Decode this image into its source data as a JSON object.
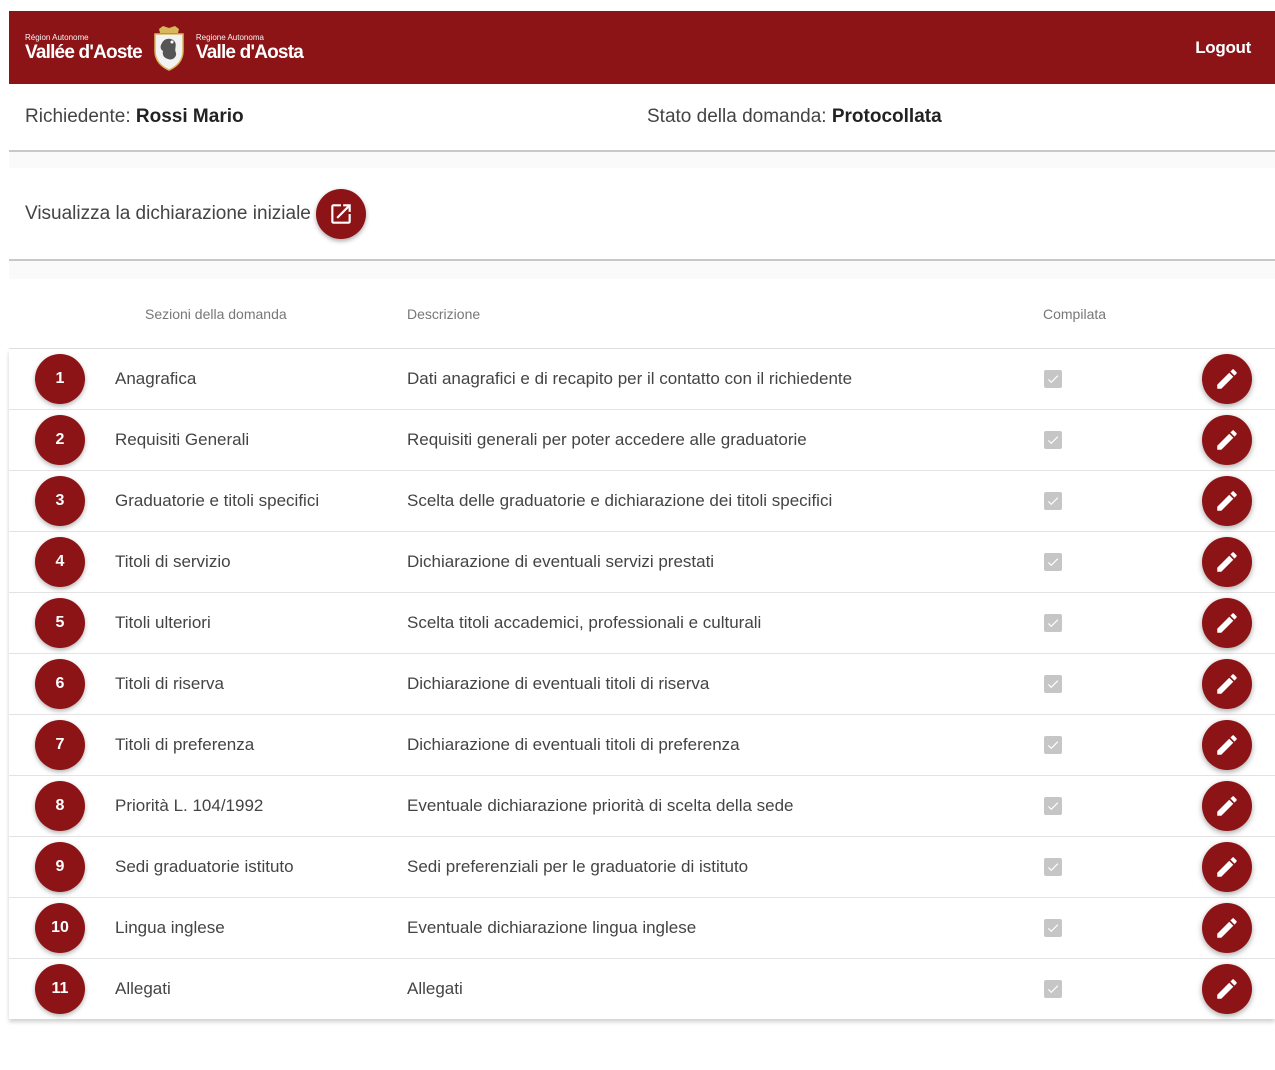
{
  "header": {
    "logo_left_small": "Région Autonome",
    "logo_left_big": "Vallée d'Aoste",
    "logo_right_small": "Regione Autonoma",
    "logo_right_big": "Valle d'Aosta",
    "logout_label": "Logout"
  },
  "info": {
    "applicant_label": "Richiedente:",
    "applicant_name": "Rossi Mario",
    "status_label": "Stato della domanda:",
    "status_value": "Protocollata"
  },
  "view": {
    "label": "Visualizza la dichiarazione iniziale",
    "icon": "open-in-new-icon"
  },
  "table": {
    "headers": {
      "sections": "Sezioni della domanda",
      "description": "Descrizione",
      "completed": "Compilata"
    },
    "rows": [
      {
        "num": "1",
        "section": "Anagrafica",
        "description": "Dati anagrafici e di recapito per il contatto con il richiedente",
        "completed": true
      },
      {
        "num": "2",
        "section": "Requisiti Generali",
        "description": "Requisiti generali per poter accedere alle graduatorie",
        "completed": true
      },
      {
        "num": "3",
        "section": "Graduatorie e titoli specifici",
        "description": "Scelta delle graduatorie e dichiarazione dei titoli specifici",
        "completed": true
      },
      {
        "num": "4",
        "section": "Titoli di servizio",
        "description": "Dichiarazione di eventuali servizi prestati",
        "completed": true
      },
      {
        "num": "5",
        "section": "Titoli ulteriori",
        "description": "Scelta titoli accademici, professionali e culturali",
        "completed": true
      },
      {
        "num": "6",
        "section": "Titoli di riserva",
        "description": "Dichiarazione di eventuali titoli di riserva",
        "completed": true
      },
      {
        "num": "7",
        "section": "Titoli di preferenza",
        "description": "Dichiarazione di eventuali titoli di preferenza",
        "completed": true
      },
      {
        "num": "8",
        "section": "Priorità L. 104/1992",
        "description": "Eventuale dichiarazione priorità di scelta della sede",
        "completed": true
      },
      {
        "num": "9",
        "section": "Sedi graduatorie istituto",
        "description": "Sedi preferenziali per le graduatorie di istituto",
        "completed": true
      },
      {
        "num": "10",
        "section": "Lingua inglese",
        "description": "Eventuale dichiarazione lingua inglese",
        "completed": true
      },
      {
        "num": "11",
        "section": "Allegati",
        "description": "Allegati",
        "completed": true
      }
    ]
  },
  "colors": {
    "brand": "#8c1416",
    "checkbox_disabled": "#c6c6c6"
  }
}
